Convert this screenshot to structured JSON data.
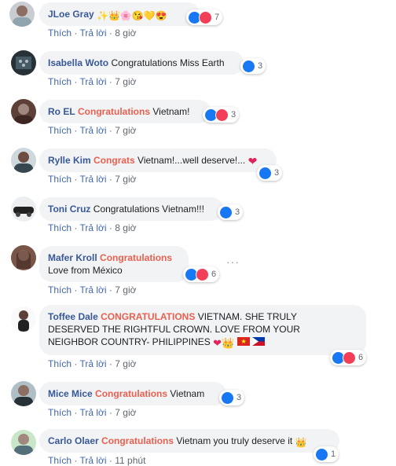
{
  "actions": {
    "like": "Thích",
    "reply": "Trả lời",
    "sep": "·"
  },
  "colors": {
    "name": "#385898",
    "highlight": "#e9604f",
    "bubble": "#f2f3f5",
    "like_blue": "#1877f2",
    "love_red": "#f33e58"
  },
  "comments": [
    {
      "name": "JLoe Gray",
      "highlight": "",
      "text": "",
      "emojis": "✨👑🌸😘💛😍",
      "reactions": [
        "like",
        "love"
      ],
      "count": "7",
      "time": "8 giờ"
    },
    {
      "name": "Isabella Woto",
      "highlight": "",
      "text": "Congratulations Miss Earth",
      "reactions": [
        "like"
      ],
      "count": "3",
      "time": "7 giờ"
    },
    {
      "name": "Ro EL",
      "highlight": "Congratulations",
      "text": "Vietnam!",
      "reactions": [
        "like",
        "love"
      ],
      "count": "3",
      "time": "7 giờ"
    },
    {
      "name": "Rylle Kim",
      "highlight": "Congrats",
      "text": "Vietnam!...well deserve!...",
      "emojis": "❤",
      "reactions": [
        "like"
      ],
      "count": "3",
      "time": "7 giờ"
    },
    {
      "name": "Toni Cruz",
      "highlight": "",
      "text": "Congratulations Vietnam!!!",
      "reactions": [
        "like"
      ],
      "count": "3",
      "time": "8 giờ"
    },
    {
      "name": "Mafer Kroll",
      "highlight": "Congratulations",
      "text": "Love from México",
      "reactions": [
        "like",
        "love"
      ],
      "count": "6",
      "time": "7 giờ",
      "more": "···"
    },
    {
      "name": "Toffee Dale",
      "highlight": "CONGRATULATIONS",
      "text1": "VIETNAM. SHE TRULY",
      "text2": "DESERVED THE RIGHTFUL CROWN. LOVE FROM YOUR",
      "text3": "NEIGHBOR COUNTRY- PHILIPPINES",
      "emojis": "❤👑",
      "reactions": [
        "like",
        "love"
      ],
      "count": "6",
      "time": "7 giờ"
    },
    {
      "name": "Mice Mice",
      "highlight": "Congratulations",
      "text": "Vietnam",
      "reactions": [
        "like"
      ],
      "count": "3",
      "time": "7 giờ"
    },
    {
      "name": "Carlo Olaer",
      "highlight": "Congratulations",
      "text": "Vietnam you truly deserve it",
      "emojis": "👑",
      "reactions": [
        "like"
      ],
      "count": "1",
      "time": "11 phút"
    }
  ]
}
